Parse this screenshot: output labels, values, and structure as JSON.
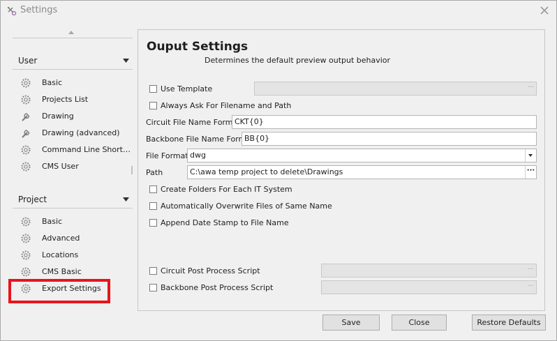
{
  "window": {
    "title": "Settings",
    "title_icon": "settings-wrench-icon",
    "close_icon": "close-icon"
  },
  "nav": {
    "user_group": {
      "label": "User",
      "items": [
        {
          "label": "Basic",
          "icon": "gear-icon"
        },
        {
          "label": "Projects List",
          "icon": "gear-icon"
        },
        {
          "label": "Drawing",
          "icon": "wrench-icon"
        },
        {
          "label": "Drawing (advanced)",
          "icon": "wrench-icon"
        },
        {
          "label": "Command Line Short…",
          "icon": "gear-icon"
        },
        {
          "label": "CMS User",
          "icon": "gear-icon"
        }
      ]
    },
    "project_group": {
      "label": "Project",
      "items": [
        {
          "label": "Basic",
          "icon": "gear-icon"
        },
        {
          "label": "Advanced",
          "icon": "gear-icon"
        },
        {
          "label": "Locations",
          "icon": "gear-icon"
        },
        {
          "label": "CMS Basic",
          "icon": "gear-icon"
        },
        {
          "label": "Export Settings",
          "icon": "gear-icon"
        }
      ]
    },
    "highlight_color": "#e8141c"
  },
  "panel": {
    "title": "Ouput Settings",
    "subtitle": "Determines the default preview output behavior",
    "use_template": {
      "label": "Use Template",
      "checked": false,
      "value": ""
    },
    "always_ask": {
      "label": "Always Ask For Filename and Path",
      "checked": false
    },
    "circuit_format": {
      "label": "Circuit File Name Format",
      "value": "CKT{0}"
    },
    "backbone_format": {
      "label": "Backbone File Name Format",
      "value": "BB{0}"
    },
    "file_format": {
      "label": "File Format",
      "value": "dwg"
    },
    "path": {
      "label": "Path",
      "value": "C:\\awa temp project to delete\\Drawings"
    },
    "create_folders": {
      "label": "Create Folders For Each IT System",
      "checked": false
    },
    "overwrite": {
      "label": "Automatically Overwrite Files of Same Name",
      "checked": false
    },
    "date_stamp": {
      "label": "Append Date Stamp to File Name",
      "checked": false
    },
    "circuit_script": {
      "label": "Circuit Post Process Script",
      "checked": false,
      "value": ""
    },
    "backbone_script": {
      "label": "Backbone Post Process Script",
      "checked": false,
      "value": ""
    },
    "ellipsis_text": "···"
  },
  "buttons": {
    "save": "Save",
    "close": "Close",
    "restore": "Restore Defaults"
  }
}
